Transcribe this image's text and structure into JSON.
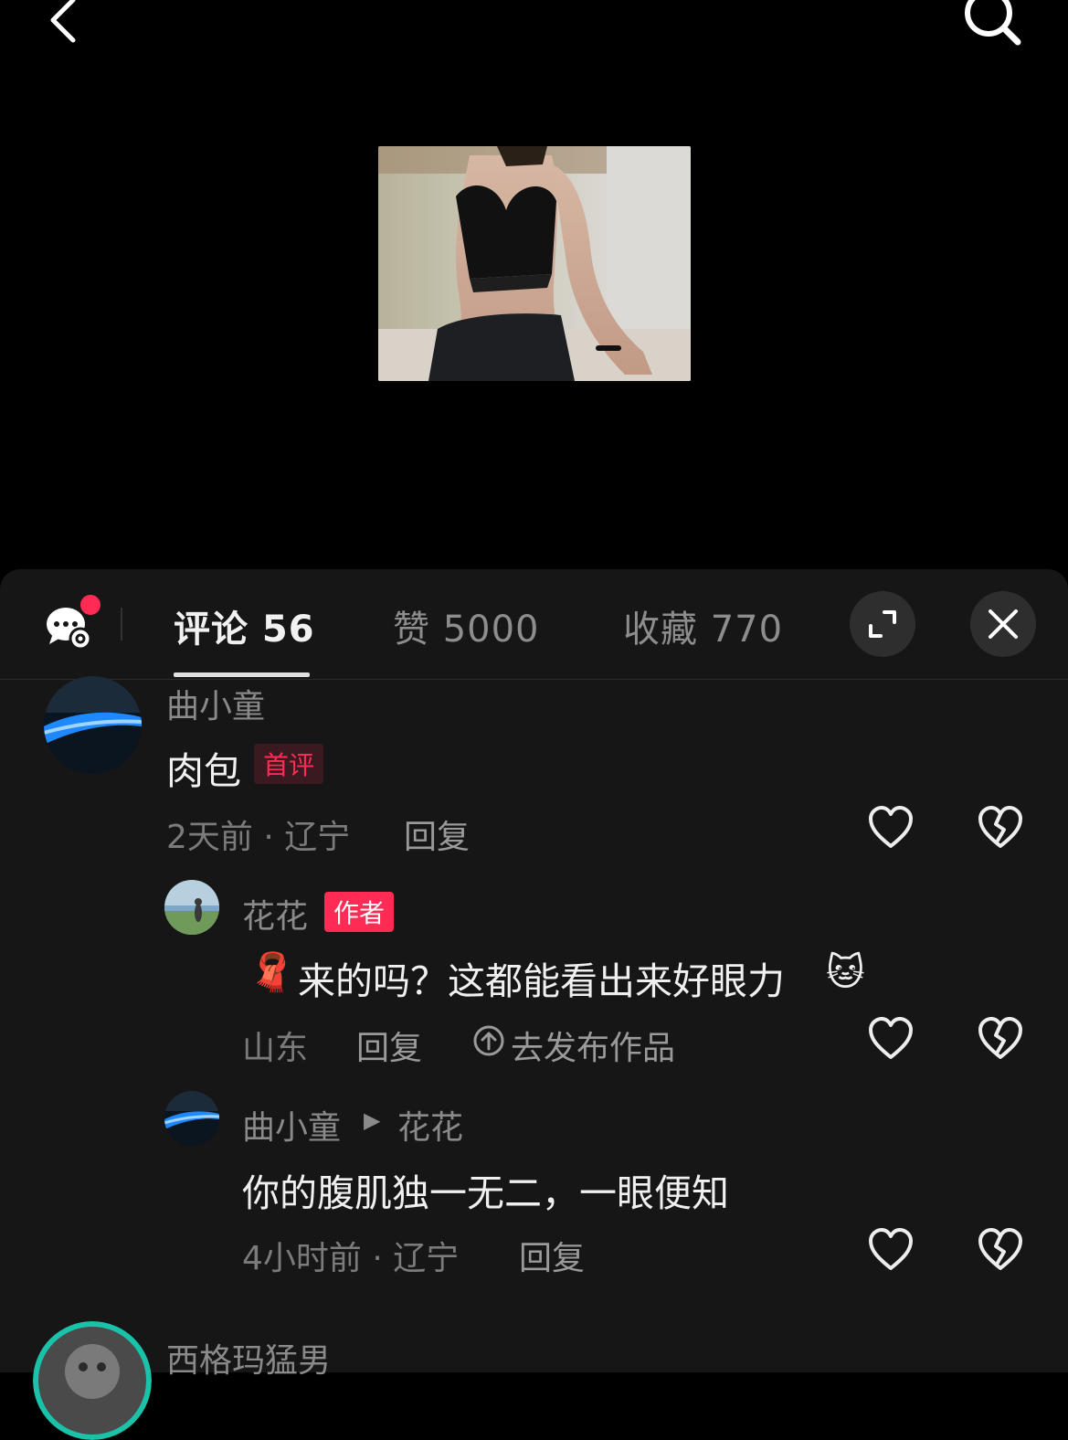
{
  "header": {},
  "tabs": {
    "comments": "评论 56",
    "likes": "赞 5000",
    "saves": "收藏 770"
  },
  "comments": [
    {
      "user": "曲小童",
      "text": "肉包",
      "badge": "首评",
      "meta": "2天前 · 辽宁",
      "reply": "回复"
    },
    {
      "user": "花花",
      "badge": "作者",
      "emoji_lead": "🧣",
      "text": "来的吗？这都能看出来好眼力",
      "emoji_tail": "🐱",
      "meta": "山东",
      "reply": "回复",
      "publish": "去发布作品"
    },
    {
      "user": "曲小童",
      "reply_to": "花花",
      "text": "你的腹肌独一无二，一眼便知",
      "meta": "4小时前 · 辽宁",
      "reply": "回复"
    },
    {
      "user": "西格玛猛男"
    }
  ],
  "colors": {
    "accent": "#fe2c55",
    "sheet_bg": "#161616",
    "page_bg": "#000000"
  },
  "icons": [
    "back-icon",
    "search-icon",
    "chat-settings-icon",
    "expand-icon",
    "close-icon",
    "heart-icon",
    "broken-heart-icon",
    "upload-circle-icon"
  ]
}
